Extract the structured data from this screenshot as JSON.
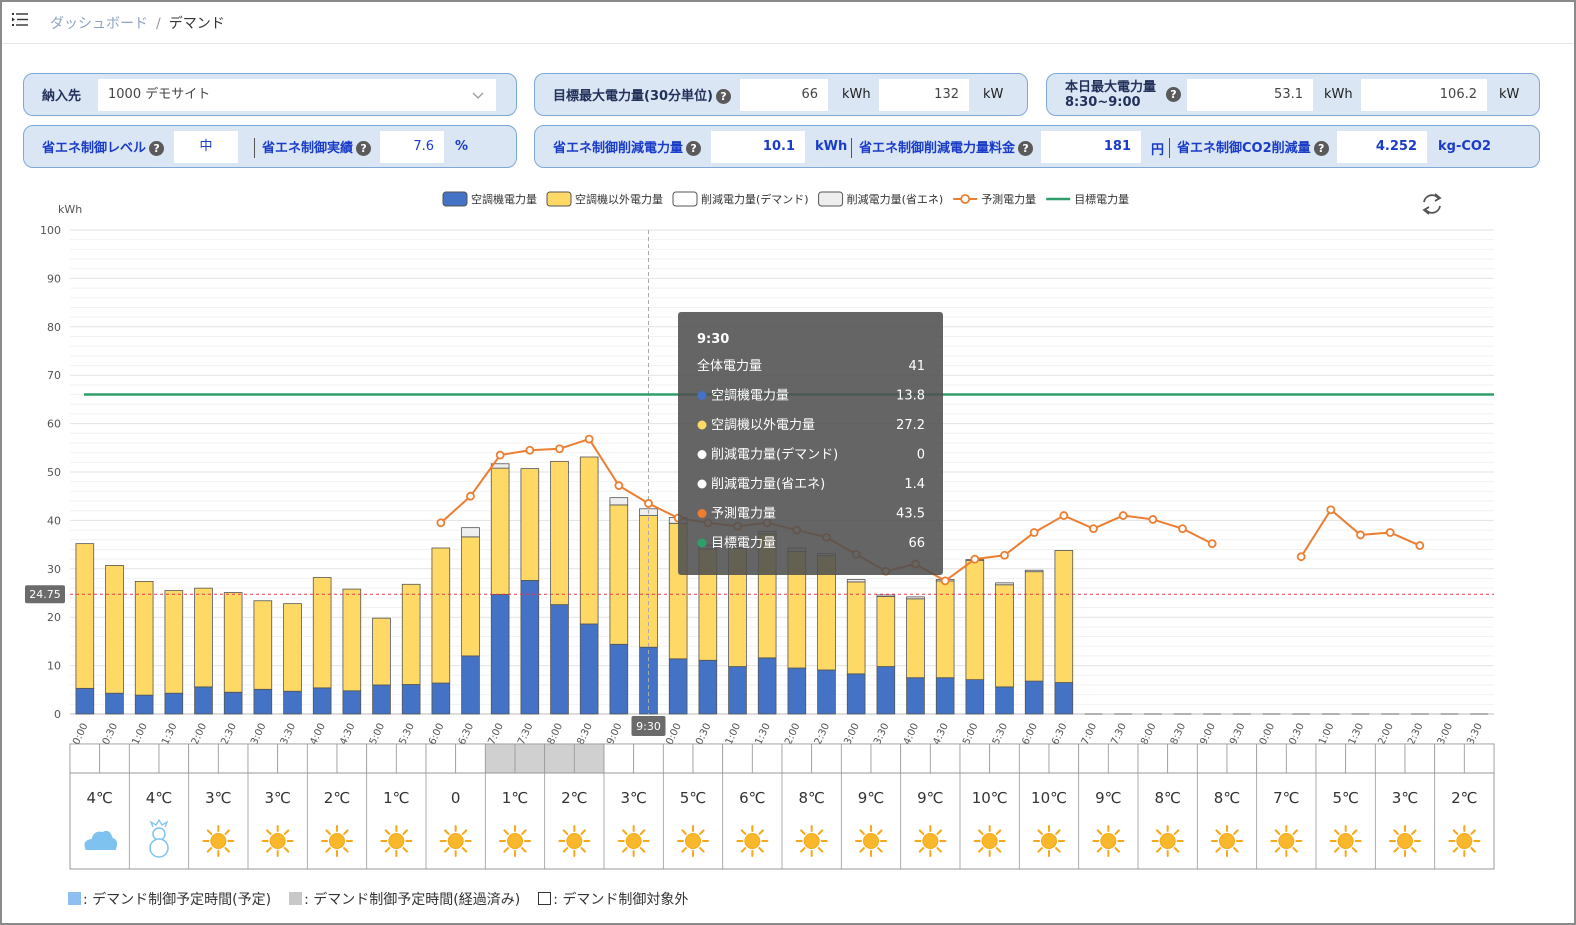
{
  "breadcrumb": {
    "home": "ダッシュボード",
    "separator": "/",
    "current": "デマンド"
  },
  "panel": {
    "supplier_label": "納入先",
    "supplier_value": "1000 デモサイト",
    "target_label": "目標最大電力量(30分単位)",
    "target_kwh": "66",
    "target_kwh_unit": "kWh",
    "target_kw": "132",
    "target_kw_unit": "kW",
    "today_max_label_1": "本日最大電力量",
    "today_max_label_2": "8:30~9:00",
    "today_max_kwh": "53.1",
    "today_max_kwh_unit": "kWh",
    "today_max_kw": "106.2",
    "today_max_kw_unit": "kW",
    "level_label": "省エネ制御レベル",
    "level_value": "中",
    "result_label": "省エネ制御実績",
    "result_value": "7.6",
    "result_unit": "%",
    "reduction_label": "省エネ制御削減電力量",
    "reduction_value": "10.1",
    "reduction_unit": "kWh",
    "fee_label": "省エネ制御削減電力量料金",
    "fee_value": "181",
    "fee_unit": "円",
    "co2_label": "省エネ制御CO2削減量",
    "co2_value": "4.252",
    "co2_unit": "kg-CO2",
    "help_glyph": "?"
  },
  "chart_data": {
    "type": "bar",
    "ylabel": "kWh",
    "ylim": [
      0,
      100
    ],
    "y_ticks": [
      "0",
      "10",
      "20",
      "30",
      "40",
      "50",
      "60",
      "70",
      "80",
      "90",
      "100"
    ],
    "categories": [
      "0:00",
      "0:30",
      "1:00",
      "1:30",
      "2:00",
      "2:30",
      "3:00",
      "3:30",
      "4:00",
      "4:30",
      "5:00",
      "5:30",
      "6:00",
      "6:30",
      "7:00",
      "7:30",
      "8:00",
      "8:30",
      "9:00",
      "9:30",
      "10:00",
      "10:30",
      "11:00",
      "11:30",
      "12:00",
      "12:30",
      "13:00",
      "13:30",
      "14:00",
      "14:30",
      "15:00",
      "15:30",
      "16:00",
      "16:30",
      "17:00",
      "17:30",
      "18:00",
      "18:30",
      "19:00",
      "19:30",
      "20:00",
      "20:30",
      "21:00",
      "21:30",
      "22:00",
      "22:30",
      "23:00",
      "23:30"
    ],
    "legend": [
      "空調機電力量",
      "空調機以外電力量",
      "削減電力量(デマンド)",
      "削減電力量(省エネ)",
      "予測電力量",
      "目標電力量"
    ],
    "series": [
      {
        "name": "空調機電力量",
        "color": "#4472c4",
        "values": [
          5.3,
          4.3,
          3.9,
          4.3,
          5.6,
          4.5,
          5.1,
          4.7,
          5.4,
          4.8,
          6,
          6.1,
          6.4,
          12,
          24.7,
          27.6,
          22.6,
          18.6,
          14.4,
          13.8,
          11.4,
          11.1,
          9.8,
          11.6,
          9.5,
          9.1,
          8.3,
          9.8,
          7.5,
          7.5,
          7.1,
          5.6,
          6.8,
          6.5,
          null,
          null,
          null,
          null,
          null,
          null,
          null,
          null,
          null,
          null,
          null,
          null,
          null,
          null
        ]
      },
      {
        "name": "空調機以外電力量",
        "color": "#ffd966",
        "values": [
          29.9,
          26.4,
          23.5,
          21.2,
          20.4,
          20.6,
          18.3,
          18.1,
          22.8,
          21,
          13.8,
          20.7,
          27.9,
          24.6,
          26.1,
          23.1,
          29.6,
          34.5,
          28.8,
          27.2,
          28,
          23,
          24.4,
          25.6,
          24.1,
          23.6,
          19,
          14.5,
          16.3,
          20,
          24.6,
          21.1,
          22.6,
          27.3,
          null,
          null,
          null,
          null,
          null,
          null,
          null,
          null,
          null,
          null,
          null,
          null,
          null,
          null
        ]
      },
      {
        "name": "削減電力量(デマンド)",
        "color": "#ffffff",
        "values": [
          0,
          0,
          0,
          0,
          0,
          0,
          0,
          0,
          0,
          0,
          0,
          0,
          0,
          0,
          0,
          0,
          0,
          0,
          0,
          0,
          0,
          0,
          0,
          0,
          0,
          0,
          0,
          0,
          0,
          0,
          0,
          0,
          0,
          0,
          null,
          null,
          null,
          null,
          null,
          null,
          null,
          null,
          null,
          null,
          null,
          null,
          null,
          null
        ]
      },
      {
        "name": "削減電力量(省エネ)",
        "color": "#eeeeee",
        "values": [
          0,
          0,
          0,
          0,
          0,
          0,
          0,
          0,
          0,
          0,
          0,
          0,
          0,
          1.9,
          0.9,
          0,
          0,
          0,
          1.5,
          1.4,
          1.2,
          0.8,
          0.6,
          0.5,
          0.7,
          0.5,
          0.5,
          0.3,
          0.4,
          0.3,
          0.2,
          0.4,
          0.3,
          0,
          null,
          null,
          null,
          null,
          null,
          null,
          null,
          null,
          null,
          null,
          null,
          null,
          null,
          null
        ]
      },
      {
        "name": "予測電力量",
        "color": "#ed7d31",
        "values": [
          null,
          null,
          null,
          null,
          null,
          null,
          null,
          null,
          null,
          null,
          null,
          null,
          39.5,
          45,
          53.5,
          54.5,
          54.8,
          56.8,
          47.2,
          43.5,
          40.5,
          39.5,
          38.8,
          39.5,
          38,
          36.5,
          33,
          29.5,
          31,
          27.5,
          32,
          32.8,
          37.5,
          41,
          38.3,
          41,
          40.2,
          38.3,
          35.2,
          null,
          null,
          32.5,
          42.2,
          37,
          37.5,
          34.8,
          null,
          null
        ]
      },
      {
        "name": "目標電力量",
        "color": "#2e9e6b",
        "values": [
          66
        ]
      }
    ],
    "threshold_line": {
      "value": 24.75,
      "label": "24.75"
    },
    "cursor_category": "9:30",
    "demand_control_past": [
      "7:00",
      "7:30",
      "8:00",
      "8:30"
    ],
    "grid": true
  },
  "tooltip": {
    "title": "9:30",
    "rows": [
      {
        "label": "全体電力量",
        "value": "41",
        "dot": ""
      },
      {
        "label": "空調機電力量",
        "value": "13.8",
        "dot": "#4472c4"
      },
      {
        "label": "空調機以外電力量",
        "value": "27.2",
        "dot": "#ffd966"
      },
      {
        "label": "削減電力量(デマンド)",
        "value": "0",
        "dot": "#ffffff"
      },
      {
        "label": "削減電力量(省エネ)",
        "value": "1.4",
        "dot": "#ffffff"
      },
      {
        "label": "予測電力量",
        "value": "43.5",
        "dot": "#ed7d31"
      },
      {
        "label": "目標電力量",
        "value": "66",
        "dot": "#2e9e6b"
      }
    ]
  },
  "weather": [
    {
      "temp": "4℃",
      "icon": "cloud-icon"
    },
    {
      "temp": "4℃",
      "icon": "snowman-icon"
    },
    {
      "temp": "3℃",
      "icon": "sun-icon"
    },
    {
      "temp": "3℃",
      "icon": "sun-icon"
    },
    {
      "temp": "2℃",
      "icon": "sun-icon"
    },
    {
      "temp": "1℃",
      "icon": "sun-icon"
    },
    {
      "temp": "0",
      "icon": "sun-icon"
    },
    {
      "temp": "1℃",
      "icon": "sun-icon"
    },
    {
      "temp": "2℃",
      "icon": "sun-icon"
    },
    {
      "temp": "3℃",
      "icon": "sun-icon"
    },
    {
      "temp": "5℃",
      "icon": "sun-icon"
    },
    {
      "temp": "6℃",
      "icon": "sun-icon"
    },
    {
      "temp": "8℃",
      "icon": "sun-icon"
    },
    {
      "temp": "9℃",
      "icon": "sun-icon"
    },
    {
      "temp": "9℃",
      "icon": "sun-icon"
    },
    {
      "temp": "10℃",
      "icon": "sun-icon"
    },
    {
      "temp": "10℃",
      "icon": "sun-icon"
    },
    {
      "temp": "9℃",
      "icon": "sun-icon"
    },
    {
      "temp": "8℃",
      "icon": "sun-icon"
    },
    {
      "temp": "8℃",
      "icon": "sun-icon"
    },
    {
      "temp": "7℃",
      "icon": "sun-icon"
    },
    {
      "temp": "5℃",
      "icon": "sun-icon"
    },
    {
      "temp": "3℃",
      "icon": "sun-icon"
    },
    {
      "temp": "2℃",
      "icon": "sun-icon"
    }
  ],
  "bottom_legend": {
    "planned": ": デマンド制御予定時間(予定)",
    "passed": ": デマンド制御予定時間(経過済み)",
    "excluded": ": デマンド制御対象外",
    "planned_color": "#8fbff0",
    "passed_color": "#c8c8c8"
  }
}
